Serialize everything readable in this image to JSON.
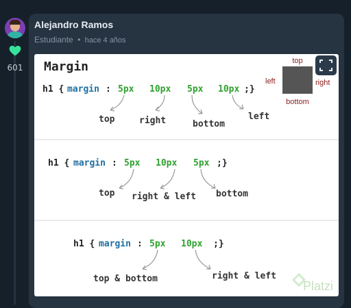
{
  "comment": {
    "author": "Alejandro Ramos",
    "role": "Estudiante",
    "separator": "•",
    "time": "hace 4 años",
    "likes": "601"
  },
  "image": {
    "title": "Margin",
    "box_labels": {
      "top": "top",
      "left": "left",
      "right": "right",
      "bottom": "bottom"
    },
    "example1": {
      "selector": "h1 {",
      "property": "margin",
      "colon": ":",
      "values": [
        "5px",
        "10px",
        "5px",
        "10px"
      ],
      "end": ";}",
      "labels": [
        "top",
        "right",
        "bottom",
        "left"
      ]
    },
    "example2": {
      "selector": "h1 {",
      "property": "margin",
      "colon": ":",
      "values": [
        "5px",
        "10px",
        "5px"
      ],
      "end": ";}",
      "labels": [
        "top",
        "right & left",
        "bottom"
      ]
    },
    "example3": {
      "selector": "h1 {",
      "property": "margin",
      "colon": ":",
      "values": [
        "5px",
        "10px"
      ],
      "end": ";}",
      "labels": [
        "top & bottom",
        "right & left"
      ]
    },
    "watermark": "Platzi"
  },
  "colors": {
    "property": "#1f6fa0",
    "value": "#2ea12e",
    "heart": "#35e39a"
  },
  "icons": [
    "heart-icon",
    "expand-icon",
    "platzi-logo"
  ]
}
